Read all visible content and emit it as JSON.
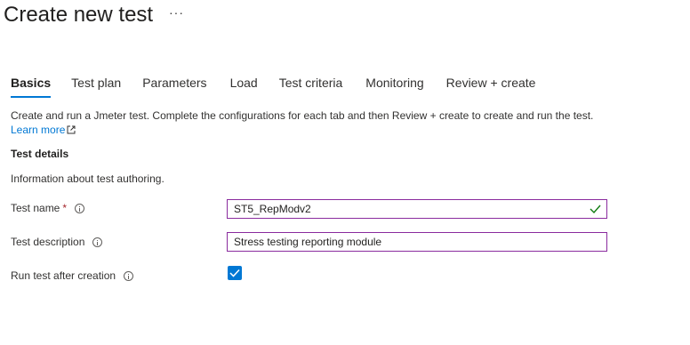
{
  "header": {
    "title": "Create new test",
    "more_label": "···"
  },
  "tabs": [
    {
      "label": "Basics",
      "active": true
    },
    {
      "label": "Test plan",
      "active": false
    },
    {
      "label": "Parameters",
      "active": false
    },
    {
      "label": "Load",
      "active": false
    },
    {
      "label": "Test criteria",
      "active": false
    },
    {
      "label": "Monitoring",
      "active": false
    },
    {
      "label": "Review + create",
      "active": false
    }
  ],
  "intro": {
    "text": "Create and run a Jmeter test. Complete the configurations for each tab and then Review + create to create and run the test.",
    "learn_more": "Learn more"
  },
  "section": {
    "heading": "Test details",
    "description": "Information about test authoring."
  },
  "form": {
    "test_name": {
      "label": "Test name",
      "required_marker": "*",
      "value": "ST5_RepModv2",
      "valid": true
    },
    "test_description": {
      "label": "Test description",
      "value": "Stress testing reporting module"
    },
    "run_after_creation": {
      "label": "Run test after creation",
      "checked": true
    }
  },
  "colors": {
    "accent": "#0078d4",
    "input_border": "#8a2b9e",
    "valid_check": "#107c10",
    "required": "#a4262c"
  }
}
